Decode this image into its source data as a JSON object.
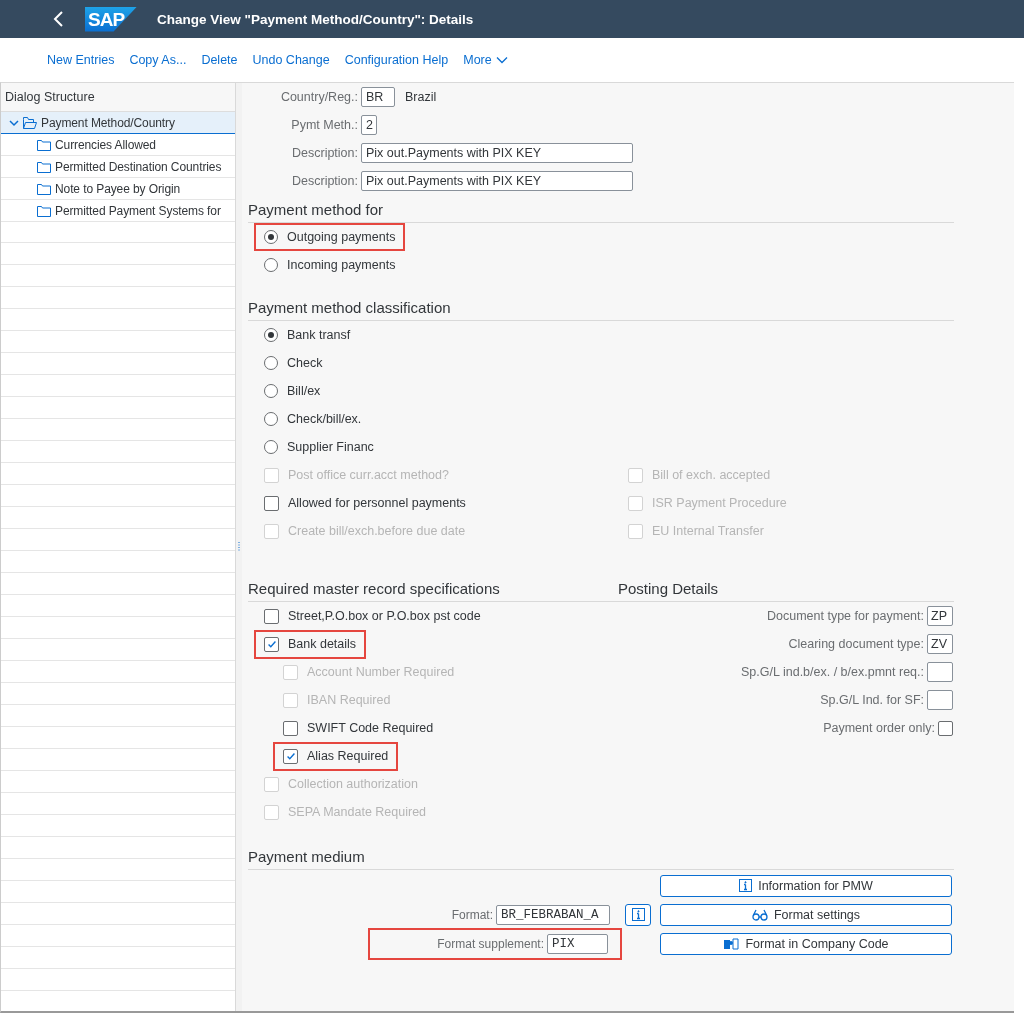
{
  "header": {
    "logo": "SAP",
    "title": "Change View \"Payment Method/Country\": Details"
  },
  "toolbar": [
    {
      "label": "New Entries",
      "kind": "action"
    },
    {
      "label": "Copy As...",
      "kind": "action"
    },
    {
      "label": "Delete",
      "kind": "action"
    },
    {
      "label": "Undo Change",
      "kind": "action"
    },
    {
      "label": "Configuration Help",
      "kind": "action"
    },
    {
      "label": "More",
      "kind": "menu"
    }
  ],
  "dialog_structure": {
    "title": "Dialog Structure",
    "items": [
      {
        "label": "Payment Method/Country",
        "selected": true,
        "expanded": true,
        "children": [
          {
            "label": "Currencies Allowed",
            "selected": false
          },
          {
            "label": "Permitted Destination Countries",
            "selected": false
          },
          {
            "label": "Note to Payee by Origin",
            "selected": false
          },
          {
            "label": "Permitted Payment Systems for",
            "selected": false
          }
        ]
      }
    ]
  },
  "key_fields": [
    {
      "label": "Country/Reg.:",
      "value": "BR",
      "note": "Brazil"
    },
    {
      "label": "Pymt Meth.:",
      "value": "2"
    },
    {
      "label": "Description:",
      "value": "Pix out.Payments with PIX KEY"
    },
    {
      "label": "Description:",
      "value": "Pix out.Payments with PIX KEY"
    }
  ],
  "payment_method_for": {
    "title": "Payment method for",
    "options": [
      {
        "label": "Outgoing payments",
        "selected": true,
        "highlighted": true
      },
      {
        "label": "Incoming payments",
        "selected": false,
        "highlighted": false
      }
    ]
  },
  "classification": {
    "title": "Payment method classification",
    "options": [
      {
        "label": "Bank transf",
        "selected": true
      },
      {
        "label": "Check",
        "selected": false
      },
      {
        "label": "Bill/ex",
        "selected": false
      },
      {
        "label": "Check/bill/ex.",
        "selected": false
      },
      {
        "label": "Supplier Financ",
        "selected": false
      }
    ],
    "checkboxes": [
      {
        "label": "Post office curr.acct method?",
        "checked": false,
        "disabled": true
      },
      {
        "label": "Bill of exch. accepted",
        "checked": false,
        "disabled": true
      },
      {
        "label": "Allowed for personnel payments",
        "checked": false,
        "disabled": false
      },
      {
        "label": "ISR Payment Procedure",
        "checked": false,
        "disabled": true
      },
      {
        "label": "Create bill/exch.before due date",
        "checked": false,
        "disabled": true
      },
      {
        "label": "EU Internal Transfer",
        "checked": false,
        "disabled": true
      }
    ]
  },
  "master_record": {
    "title": "Required master record specifications",
    "items": [
      {
        "label": "Street,P.O.box or P.O.box pst code",
        "checked": false,
        "disabled": false,
        "highlighted": false
      },
      {
        "label": "Bank details",
        "checked": true,
        "disabled": false,
        "highlighted": true,
        "children": [
          {
            "label": "Account Number Required",
            "checked": false,
            "disabled": true,
            "highlighted": false
          },
          {
            "label": "IBAN Required",
            "checked": false,
            "disabled": true,
            "highlighted": false
          },
          {
            "label": "SWIFT Code Required",
            "checked": false,
            "disabled": false,
            "highlighted": false
          },
          {
            "label": "Alias Required",
            "checked": true,
            "disabled": false,
            "highlighted": true
          }
        ]
      },
      {
        "label": "Collection authorization",
        "checked": false,
        "disabled": true,
        "highlighted": false
      },
      {
        "label": "SEPA Mandate Required",
        "checked": false,
        "disabled": true,
        "highlighted": false
      }
    ]
  },
  "posting_details": {
    "title": "Posting Details",
    "fields": [
      {
        "label": "Document type for payment:",
        "kind": "text",
        "value": "ZP"
      },
      {
        "label": "Clearing document type:",
        "kind": "text",
        "value": "ZV"
      },
      {
        "label": "Sp.G/L ind.b/ex. / b/ex.pmnt req.:",
        "kind": "text"
      },
      {
        "label": "Sp.G/L Ind. for SF:",
        "kind": "text"
      },
      {
        "label": "Payment order only:",
        "kind": "checkbox",
        "checked": false
      }
    ]
  },
  "payment_medium": {
    "title": "Payment medium",
    "fields": [
      {
        "label": "Format:",
        "value": "BR_FEBRABAN_A",
        "highlighted": false
      },
      {
        "label": "Format supplement:",
        "value": "PIX",
        "highlighted": true
      }
    ],
    "buttons": [
      {
        "label": "Information for PMW"
      },
      {
        "label": "Format settings"
      },
      {
        "label": "Format in Company Code"
      }
    ]
  }
}
